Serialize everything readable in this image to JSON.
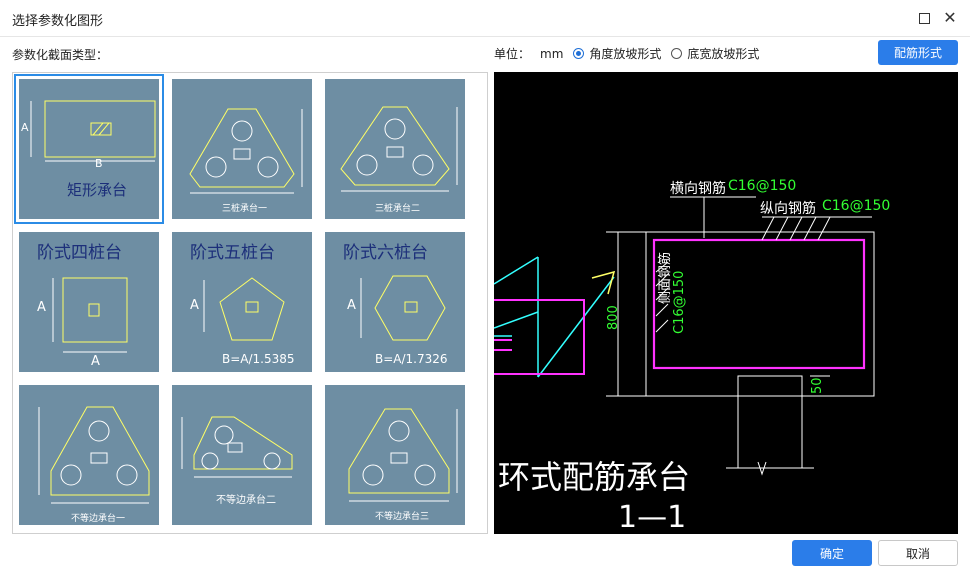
{
  "window": {
    "title": "选择参数化图形"
  },
  "section_label": "参数化截面类型：",
  "units": {
    "label": "单位：",
    "value": "mm"
  },
  "slope_options": [
    {
      "label": "角度放坡形式",
      "selected": true
    },
    {
      "label": "底宽放坡形式",
      "selected": false
    }
  ],
  "rebar_button": "配筋形式",
  "thumbnails": [
    {
      "caption": "矩形承台",
      "dim_a": "A",
      "dim_b": "B",
      "selected": true
    },
    {
      "caption": "三桩承台一"
    },
    {
      "caption": "三桩承台二"
    },
    {
      "caption": "阶式四桩台",
      "dim_a": "A",
      "dim_b": "A"
    },
    {
      "caption": "阶式五桩台",
      "dim_a": "A",
      "formula": "B=A/1.5385"
    },
    {
      "caption": "阶式六桩台",
      "dim_a": "A",
      "formula": "B=A/1.7326"
    },
    {
      "caption": "不等边承台一"
    },
    {
      "caption": "不等边承台二"
    },
    {
      "caption": "不等边承台三"
    }
  ],
  "preview": {
    "transverse_rebar": "横向钢筋",
    "transverse_spec": "C16@150",
    "longitudinal_rebar": "纵向钢筋",
    "longitudinal_spec": "C16@150",
    "side_rebar": "侧面钢筋",
    "side_spec": "C16@150",
    "height_dim": "800",
    "offset_dim": "50",
    "heading": "环式配筋承台",
    "section_mark": "1—1"
  },
  "buttons": {
    "ok": "确定",
    "cancel": "取消"
  },
  "colors": {
    "primary": "#2b7de9",
    "thumb_bg": "#6e8ea3",
    "cad_yellow": "#ffff66",
    "cad_magenta": "#ff33ff",
    "cad_green": "#33ff33"
  }
}
